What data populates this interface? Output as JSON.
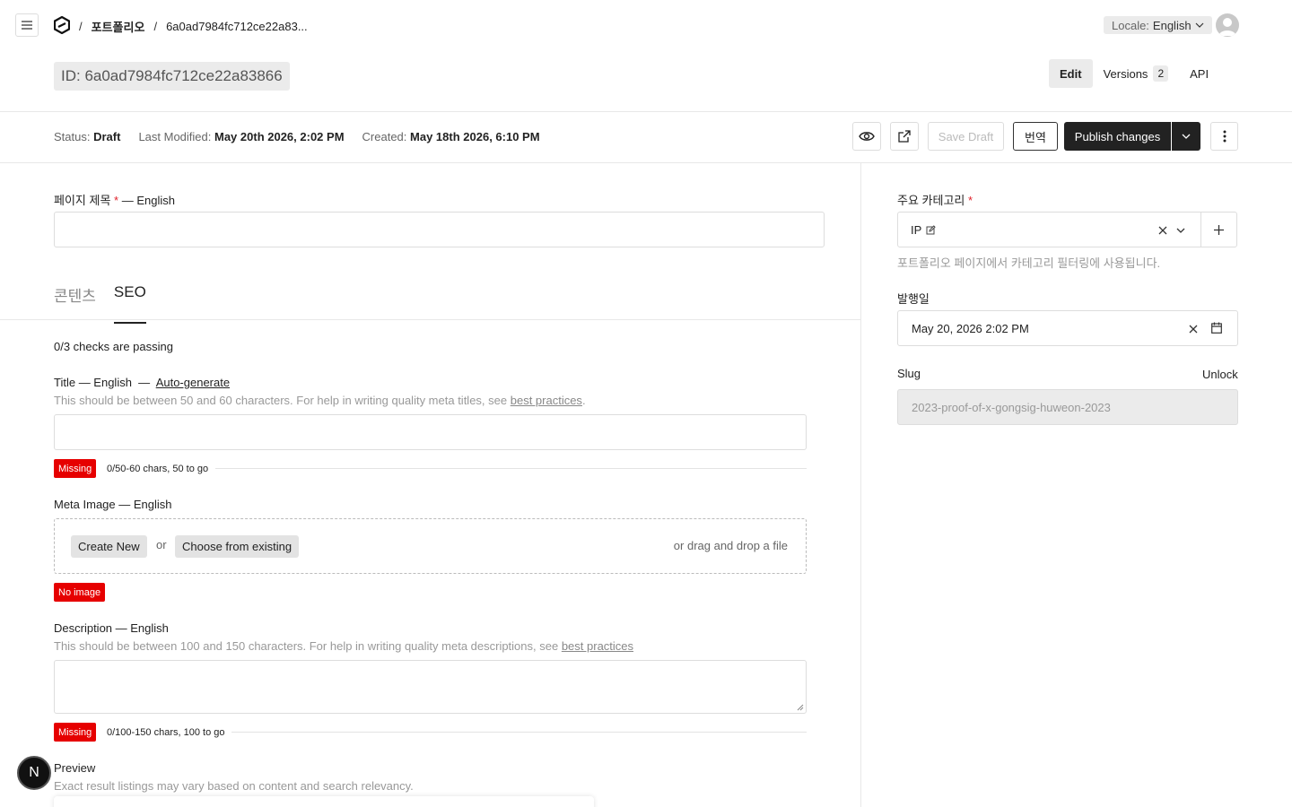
{
  "breadcrumb": {
    "sep": "/",
    "collection": "포트폴리오",
    "doc": "6a0ad7984fc712ce22a83..."
  },
  "locale": {
    "label": "Locale:",
    "value": "English"
  },
  "doc": {
    "id_label": "ID: 6a0ad7984fc712ce22a83866"
  },
  "view_tabs": {
    "edit": "Edit",
    "versions": "Versions",
    "versions_count": "2",
    "api": "API"
  },
  "status": {
    "status_key": "Status:",
    "status_val": "Draft",
    "modified_key": "Last Modified:",
    "modified_val": "May 20th 2026, 2:02 PM",
    "created_key": "Created:",
    "created_val": "May 18th 2026, 6:10 PM"
  },
  "actions": {
    "save_draft": "Save Draft",
    "translate": "번역",
    "publish": "Publish changes"
  },
  "page_title_field": {
    "label": "페이지 제목",
    "req": "*",
    "suffix": "— English",
    "value": ""
  },
  "tabs": {
    "content": "콘텐츠",
    "seo": "SEO"
  },
  "seo": {
    "checks": "0/3 checks are passing",
    "title_label": "Title — English",
    "title_sep": "—",
    "auto_generate": "Auto-generate",
    "title_hint": "This should be between 50 and 60 characters. For help in writing quality meta titles, see ",
    "best_practices": "best practices",
    "title_hint_end": ".",
    "title_badge": "Missing",
    "title_count": "0/50-60 chars, 50 to go",
    "image_label": "Meta Image — English",
    "create_new": "Create New",
    "or": "or",
    "choose_existing": "Choose from existing",
    "drag_drop": "or drag and drop a file",
    "image_badge": "No image",
    "desc_label": "Description — English",
    "desc_hint": "This should be between 100 and 150 characters. For help in writing quality meta descriptions, see ",
    "desc_badge": "Missing",
    "desc_count": "0/100-150 chars, 100 to go",
    "preview_label": "Preview",
    "preview_hint": "Exact result listings may vary based on content and search relevancy."
  },
  "sidebar": {
    "category_label": "주요 카테고리",
    "category_req": "*",
    "category_value": "IP",
    "category_hint": "포트폴리오 페이지에서 카테고리 필터링에 사용됩니다.",
    "date_label": "발행일",
    "date_value": "May 20, 2026 2:02 PM",
    "slug_label": "Slug",
    "unlock": "Unlock",
    "slug_value": "2023-proof-of-x-gongsig-huweon-2023"
  },
  "dev_badge": "N"
}
